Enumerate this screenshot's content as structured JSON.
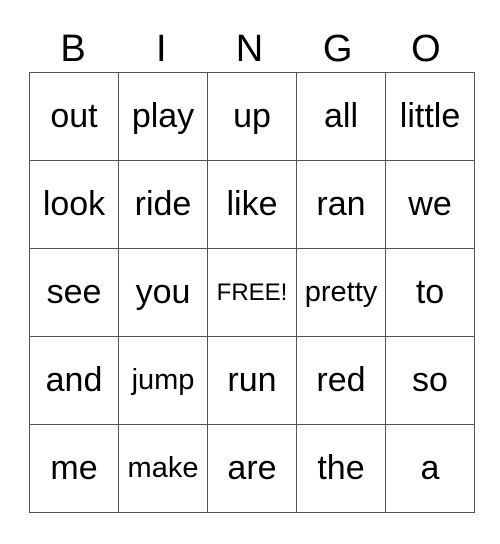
{
  "header": [
    "B",
    "I",
    "N",
    "G",
    "O"
  ],
  "rows": [
    [
      "out",
      "play",
      "up",
      "all",
      "little"
    ],
    [
      "look",
      "ride",
      "like",
      "ran",
      "we"
    ],
    [
      "see",
      "you",
      "FREE!",
      "pretty",
      "to"
    ],
    [
      "and",
      "jump",
      "run",
      "red",
      "so"
    ],
    [
      "me",
      "make",
      "are",
      "the",
      "a"
    ]
  ],
  "colors": {
    "grid_line": "#555555",
    "text": "#000000",
    "background": "#ffffff"
  }
}
